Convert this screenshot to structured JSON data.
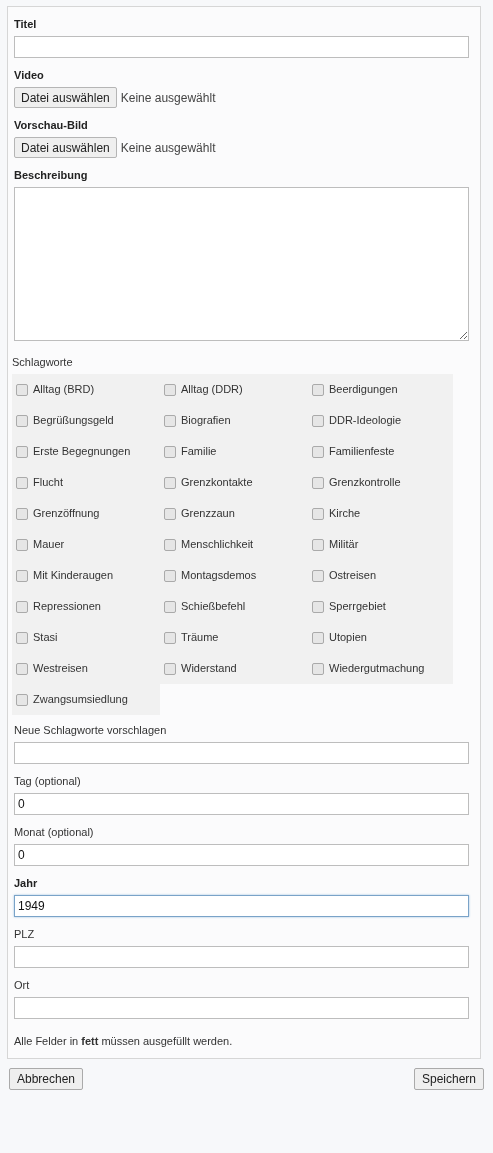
{
  "fields": [
    {
      "kind": "text",
      "label": "Titel",
      "required": true
    },
    {
      "kind": "file",
      "label": "Video",
      "required": true,
      "button": "Datei auswählen",
      "status": "Keine ausgewählt"
    },
    {
      "kind": "file",
      "label": "Vorschau-Bild",
      "required": true,
      "button": "Datei auswählen",
      "status": "Keine ausgewählt"
    },
    {
      "kind": "textarea",
      "label": "Beschreibung",
      "required": true
    },
    {
      "kind": "checkboxes",
      "label": "Schlagworte",
      "required": false,
      "options": [
        {
          "label": "Alltag (BRD)",
          "checked": false
        },
        {
          "label": "Alltag (DDR)",
          "checked": false
        },
        {
          "label": "Beerdigungen",
          "checked": false
        },
        {
          "label": "Begrüßungsgeld",
          "checked": false
        },
        {
          "label": "Biografien",
          "checked": false
        },
        {
          "label": "DDR-Ideologie",
          "checked": false
        },
        {
          "label": "Erste Begegnungen",
          "checked": false
        },
        {
          "label": "Familie",
          "checked": false
        },
        {
          "label": "Familienfeste",
          "checked": false
        },
        {
          "label": "Flucht",
          "checked": false
        },
        {
          "label": "Grenzkontakte",
          "checked": false
        },
        {
          "label": "Grenzkontrolle",
          "checked": false
        },
        {
          "label": "Grenzöffnung",
          "checked": false
        },
        {
          "label": "Grenzzaun",
          "checked": false
        },
        {
          "label": "Kirche",
          "checked": false
        },
        {
          "label": "Mauer",
          "checked": false
        },
        {
          "label": "Menschlichkeit",
          "checked": false
        },
        {
          "label": "Militär",
          "checked": false
        },
        {
          "label": "Mit Kinderaugen",
          "checked": false
        },
        {
          "label": "Montagsdemos",
          "checked": false
        },
        {
          "label": "Ostreisen",
          "checked": false
        },
        {
          "label": "Repressionen",
          "checked": false
        },
        {
          "label": "Schießbefehl",
          "checked": false
        },
        {
          "label": "Sperrgebiet",
          "checked": false
        },
        {
          "label": "Stasi",
          "checked": false
        },
        {
          "label": "Träume",
          "checked": false
        },
        {
          "label": "Utopien",
          "checked": false
        },
        {
          "label": "Westreisen",
          "checked": false
        },
        {
          "label": "Widerstand",
          "checked": false
        },
        {
          "label": "Wiedergutmachung",
          "checked": false
        },
        {
          "label": "Zwangsumsiedlung",
          "checked": false
        }
      ]
    },
    {
      "kind": "text",
      "label": "Neue Schlagworte vorschlagen",
      "required": false
    },
    {
      "kind": "text",
      "label": "Tag (optional)",
      "required": false,
      "value": "0"
    },
    {
      "kind": "text",
      "label": "Monat (optional)",
      "required": false,
      "value": "0"
    },
    {
      "kind": "text",
      "label": "Jahr",
      "required": true,
      "value": "1949",
      "focused": true
    },
    {
      "kind": "text",
      "label": "PLZ",
      "required": false
    },
    {
      "kind": "text",
      "label": "Ort",
      "required": false
    }
  ],
  "note": "Alle Felder in **fett** müssen ausgefüllt werden.",
  "buttons": {
    "cancel": "Abbrechen",
    "save": "Speichern"
  }
}
